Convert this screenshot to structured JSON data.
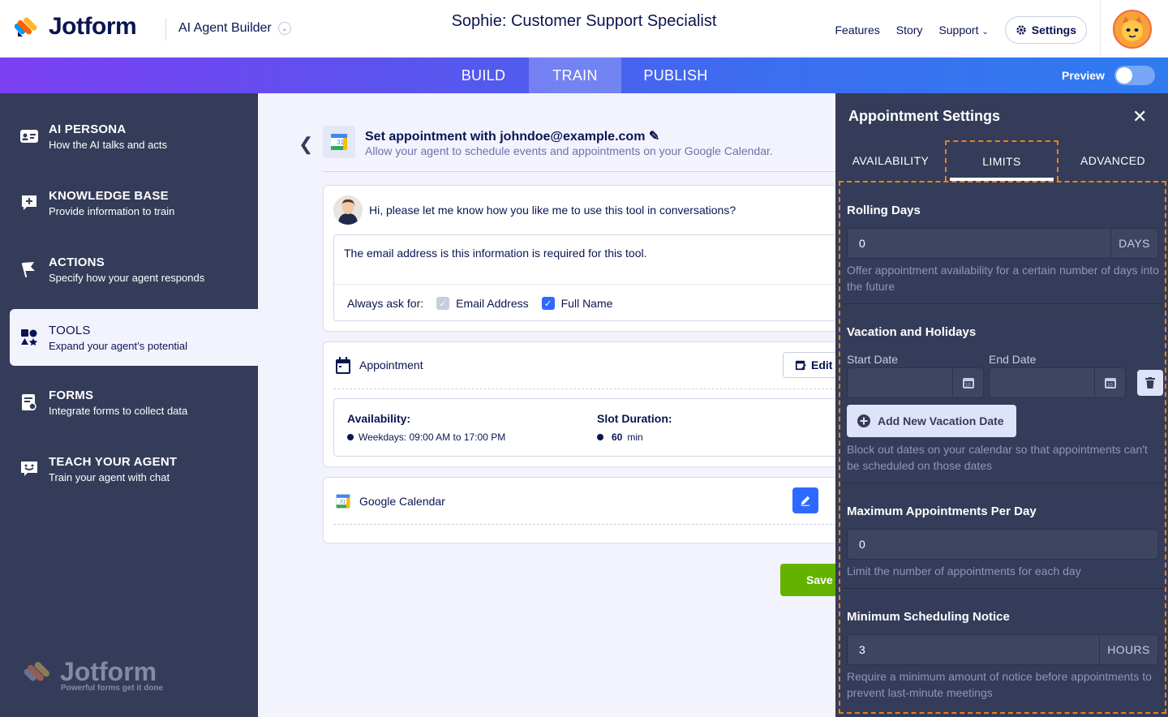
{
  "header": {
    "logo_text": "Jotform",
    "product_label": "AI Agent Builder",
    "agent_title": "Sophie: Customer Support Specialist",
    "nav": [
      "Features",
      "Story",
      "Support"
    ],
    "settings_label": "Settings"
  },
  "tabs": {
    "build": "BUILD",
    "train": "TRAIN",
    "publish": "PUBLISH",
    "active": "TRAIN",
    "preview_label": "Preview",
    "preview_on": false
  },
  "sidebar": {
    "items": [
      {
        "title": "AI PERSONA",
        "subtitle": "How the AI talks and acts",
        "icon": "id-card-icon"
      },
      {
        "title": "KNOWLEDGE BASE",
        "subtitle": "Provide information to train",
        "icon": "knowledge-add-icon"
      },
      {
        "title": "ACTIONS",
        "subtitle": "Specify how your agent responds",
        "icon": "flag-icon"
      },
      {
        "title": "TOOLS",
        "subtitle": "Expand your agent’s potential",
        "icon": "tools-icon"
      },
      {
        "title": "FORMS",
        "subtitle": "Integrate forms to collect data",
        "icon": "form-icon"
      },
      {
        "title": "TEACH YOUR AGENT",
        "subtitle": "Train your agent with chat",
        "icon": "chat-smile-icon"
      }
    ],
    "active_index": 3,
    "footer_logo": "Jotform",
    "footer_tagline": "Powerful forms get it done"
  },
  "tool": {
    "title": "Set appointment with johndoe@example.com",
    "description": "Allow your agent to schedule events and appointments on your Google Calendar.",
    "question": "Hi, please let me know how you like me to use this tool in conversations?",
    "answer": "The email address is this information is required for this tool.",
    "always_ask_label": "Always ask for:",
    "fields": [
      {
        "label": "Email Address",
        "checked": false
      },
      {
        "label": "Full Name",
        "checked": true
      }
    ],
    "appointment_label": "Appointment",
    "edit_label": "Edit",
    "availability_label": "Availability:",
    "availability_value": "Weekdays: 09:00 AM to 17:00 PM",
    "slot_label": "Slot Duration:",
    "slot_value": "60",
    "slot_unit": "min",
    "calendar_label": "Google Calendar",
    "save_label": "Save"
  },
  "panel": {
    "title": "Appointment Settings",
    "tabs": [
      "AVAILABILITY",
      "LIMITS",
      "ADVANCED"
    ],
    "active_tab": "LIMITS",
    "rolling_days": {
      "label": "Rolling Days",
      "value": "0",
      "suffix": "DAYS",
      "help": "Offer appointment availability for a certain number of days into the future"
    },
    "vacation": {
      "label": "Vacation and Holidays",
      "start_label": "Start Date",
      "end_label": "End Date",
      "start_value": "",
      "end_value": "",
      "add_label": "Add New Vacation Date",
      "help": "Block out dates on your calendar so that appointments can't be scheduled on those dates"
    },
    "max_per_day": {
      "label": "Maximum Appointments Per Day",
      "value": "0",
      "help": "Limit the number of appointments for each day"
    },
    "min_notice": {
      "label": "Minimum Scheduling Notice",
      "value": "3",
      "suffix": "HOURS",
      "help": "Require a minimum amount of notice before appointments to prevent last-minute meetings"
    }
  },
  "colors": {
    "accent_blue": "#2e69ff",
    "sidebar_bg": "#343c59",
    "save_green": "#64b200",
    "highlight_orange": "#f07f12"
  }
}
